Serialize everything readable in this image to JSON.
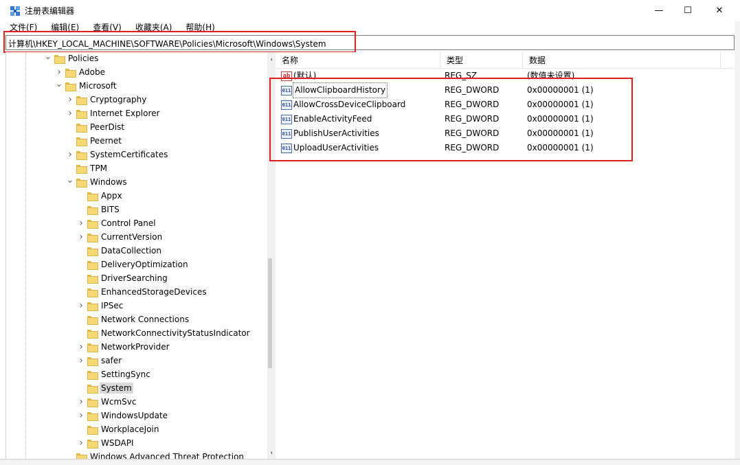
{
  "window": {
    "title": "注册表编辑器",
    "minimize_glyph": "—",
    "maximize_glyph": "☐",
    "close_glyph": "✕"
  },
  "menu": [
    "文件(F)",
    "编辑(E)",
    "查看(V)",
    "收藏夹(A)",
    "帮助(H)"
  ],
  "address": {
    "path": "计算机\\HKEY_LOCAL_MACHINE\\SOFTWARE\\Policies\\Microsoft\\Windows\\System"
  },
  "tree": [
    {
      "label": "Policies",
      "level": 0,
      "state": "expanded"
    },
    {
      "label": "Adobe",
      "level": 1,
      "state": "collapsed"
    },
    {
      "label": "Microsoft",
      "level": 1,
      "state": "expanded"
    },
    {
      "label": "Cryptography",
      "level": 2,
      "state": "collapsed"
    },
    {
      "label": "Internet Explorer",
      "level": 2,
      "state": "collapsed"
    },
    {
      "label": "PeerDist",
      "level": 2,
      "state": "none"
    },
    {
      "label": "Peernet",
      "level": 2,
      "state": "none"
    },
    {
      "label": "SystemCertificates",
      "level": 2,
      "state": "collapsed"
    },
    {
      "label": "TPM",
      "level": 2,
      "state": "none"
    },
    {
      "label": "Windows",
      "level": 2,
      "state": "expanded"
    },
    {
      "label": "Appx",
      "level": 3,
      "state": "none"
    },
    {
      "label": "BITS",
      "level": 3,
      "state": "none"
    },
    {
      "label": "Control Panel",
      "level": 3,
      "state": "collapsed"
    },
    {
      "label": "CurrentVersion",
      "level": 3,
      "state": "collapsed"
    },
    {
      "label": "DataCollection",
      "level": 3,
      "state": "none"
    },
    {
      "label": "DeliveryOptimization",
      "level": 3,
      "state": "none"
    },
    {
      "label": "DriverSearching",
      "level": 3,
      "state": "none"
    },
    {
      "label": "EnhancedStorageDevices",
      "level": 3,
      "state": "none"
    },
    {
      "label": "IPSec",
      "level": 3,
      "state": "collapsed"
    },
    {
      "label": "Network Connections",
      "level": 3,
      "state": "none"
    },
    {
      "label": "NetworkConnectivityStatusIndicator",
      "level": 3,
      "state": "none"
    },
    {
      "label": "NetworkProvider",
      "level": 3,
      "state": "collapsed"
    },
    {
      "label": "safer",
      "level": 3,
      "state": "collapsed"
    },
    {
      "label": "SettingSync",
      "level": 3,
      "state": "none"
    },
    {
      "label": "System",
      "level": 3,
      "state": "none",
      "selected": true
    },
    {
      "label": "WcmSvc",
      "level": 3,
      "state": "collapsed"
    },
    {
      "label": "WindowsUpdate",
      "level": 3,
      "state": "collapsed"
    },
    {
      "label": "WorkplaceJoin",
      "level": 3,
      "state": "none"
    },
    {
      "label": "WSDAPI",
      "level": 3,
      "state": "collapsed"
    },
    {
      "label": "Windows Advanced Threat Protection",
      "level": 2,
      "state": "none"
    }
  ],
  "list": {
    "headers": {
      "name": "名称",
      "type": "类型",
      "data": "数据"
    },
    "rows": [
      {
        "icon": "string-value-icon",
        "icon_text": "ab",
        "name": "(默认)",
        "type": "REG_SZ",
        "data": "(数值未设置)"
      },
      {
        "icon": "dword-value-icon",
        "icon_text": "011",
        "name": "AllowClipboardHistory",
        "type": "REG_DWORD",
        "data": "0x00000001 (1)",
        "focused": true
      },
      {
        "icon": "dword-value-icon",
        "icon_text": "011",
        "name": "AllowCrossDeviceClipboard",
        "type": "REG_DWORD",
        "data": "0x00000001 (1)"
      },
      {
        "icon": "dword-value-icon",
        "icon_text": "011",
        "name": "EnableActivityFeed",
        "type": "REG_DWORD",
        "data": "0x00000001 (1)"
      },
      {
        "icon": "dword-value-icon",
        "icon_text": "011",
        "name": "PublishUserActivities",
        "type": "REG_DWORD",
        "data": "0x00000001 (1)"
      },
      {
        "icon": "dword-value-icon",
        "icon_text": "011",
        "name": "UploadUserActivities",
        "type": "REG_DWORD",
        "data": "0x00000001 (1)"
      }
    ]
  },
  "colors": {
    "highlight_box": "#e02020",
    "folder": "#f8d775",
    "selection": "#d9d9d9"
  }
}
